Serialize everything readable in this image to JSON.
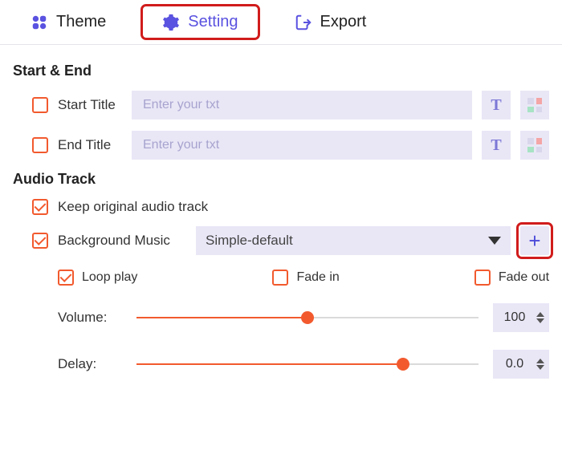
{
  "tabs": {
    "theme": "Theme",
    "setting": "Setting",
    "export": "Export",
    "active": "setting"
  },
  "sections": {
    "start_end": "Start & End",
    "audio_track": "Audio Track"
  },
  "start_end": {
    "start_title_label": "Start Title",
    "end_title_label": "End Title",
    "placeholder": "Enter your txt",
    "start_title_value": "",
    "end_title_value": "",
    "start_checked": false,
    "end_checked": false,
    "text_style_glyph": "T"
  },
  "audio": {
    "keep_original_label": "Keep original audio track",
    "keep_original_checked": true,
    "bg_music_label": "Background Music",
    "bg_music_checked": true,
    "bg_music_selected": "Simple-default",
    "loop_label": "Loop play",
    "loop_checked": true,
    "fade_in_label": "Fade in",
    "fade_in_checked": false,
    "fade_out_label": "Fade out",
    "fade_out_checked": false,
    "volume_label": "Volume:",
    "volume_value": "100",
    "volume_percent": 50,
    "delay_label": "Delay:",
    "delay_value": "0.0",
    "delay_percent": 78
  }
}
